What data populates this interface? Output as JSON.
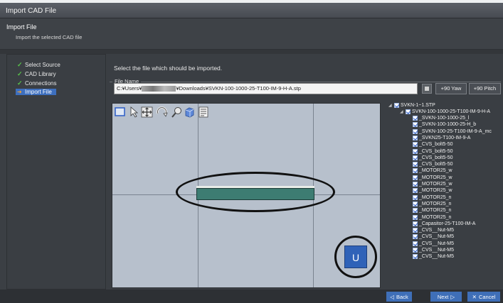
{
  "window": {
    "title": "Import CAD File"
  },
  "header": {
    "title": "Import File",
    "subtitle": "Import the selected CAD file"
  },
  "steps": [
    {
      "label": "Select Source",
      "state": "done"
    },
    {
      "label": "CAD Library",
      "state": "done"
    },
    {
      "label": "Connections",
      "state": "done"
    },
    {
      "label": "Import File",
      "state": "active"
    }
  ],
  "main": {
    "instruction": "Select the file which should be imported.",
    "file_name_label": "File Name",
    "path_prefix": "C:¥Users¥",
    "path_suffix": "¥Downloads¥SVKN-100-1000-25-T100-IM-9-H-A.stp",
    "yaw_button": "+90 Yaw",
    "pitch_button": "+90 Pitch"
  },
  "viewport": {
    "u_button": "U"
  },
  "tree": {
    "root": "SVKN-1~1.STP",
    "assembly": "SVKN-100-1000-25-T100-IM-9-H-A",
    "parts": [
      "_SVKN-100-1000-25_l",
      "_SVKN-100-1000-25-H_b",
      "_SVKN-100-25-T100-IM-9-A_mc",
      "_SVKN25-T100-IM-9-A",
      "_CVS_bolt5-50",
      "_CVS_bolt5-50",
      "_CVS_bolt5-50",
      "_CVS_bolt5-50",
      "_MOTOR25_w",
      "_MOTOR25_w",
      "_MOTOR25_w",
      "_MOTOR25_w",
      "_MOTOR25_n",
      "_MOTOR25_n",
      "_MOTOR25_n",
      "_MOTOR25_n",
      "_Capasitor-25-T100-IM-A",
      "_CVS__Nut-M5",
      "_CVS__Nut-M5",
      "_CVS__Nut-M5",
      "_CVS__Nut-M5",
      "_CVS__Nut-M5"
    ]
  },
  "footer": {
    "back": "Back",
    "next": "Next",
    "cancel": "Cancel"
  },
  "colors": {
    "accent": "#3d6fbf",
    "check": "#57c24a",
    "beam": "#3d7c72"
  }
}
